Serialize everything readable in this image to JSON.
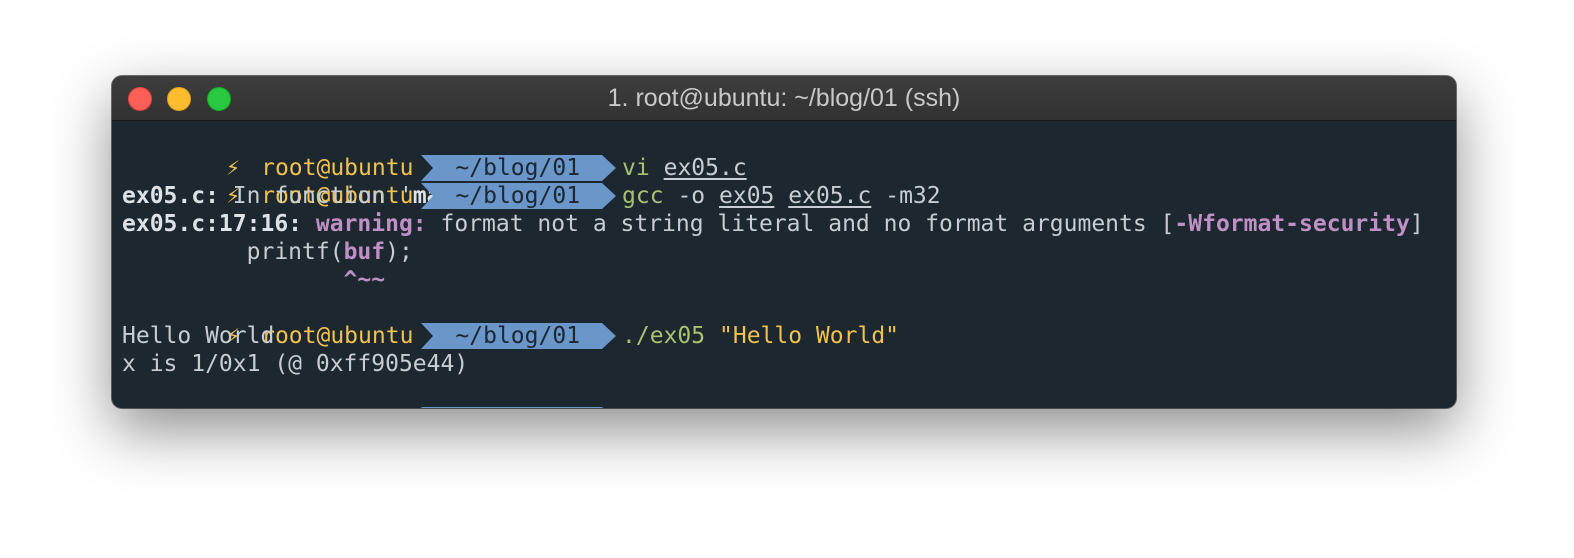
{
  "window": {
    "title": "1. root@ubuntu: ~/blog/01 (ssh)"
  },
  "prompt": {
    "icon": "lightning-bolt-icon",
    "bolt_glyph": "⚡",
    "user": "root@ubuntu",
    "dir": "~/blog/01"
  },
  "lines": {
    "l1": {
      "cmd": "vi",
      "arg1": "ex05.c"
    },
    "l2": {
      "cmd": "gcc",
      "opt1": "-o",
      "arg1": "ex05",
      "arg2": "ex05.c",
      "opt2": "-m32"
    },
    "l3": {
      "file": "ex05.c:",
      "text": " In function '",
      "fn": "main",
      "end": "':"
    },
    "l4": {
      "loc": "ex05.c:17:16:",
      "warn": "warning:",
      "msg": " format not a string literal and no format arguments [",
      "flag": "-Wformat-security",
      "end": "]"
    },
    "l5": {
      "pre": "         printf(",
      "var": "buf",
      "post": ");"
    },
    "l6": {
      "caret": "                ^~~"
    },
    "l7": {
      "cmd": "./ex05",
      "arg": "\"Hello World\""
    },
    "l8": {
      "text": "Hello World"
    },
    "l9": {
      "text": "x is 1/0x1 (@ 0xff905e44)"
    }
  },
  "colors": {
    "background": "#1c2730",
    "prompt_yellow": "#f2c14e",
    "dir_segment_blue": "#6a96c9",
    "command_green": "#a7c36f",
    "warning_magenta": "#c08fc6"
  }
}
